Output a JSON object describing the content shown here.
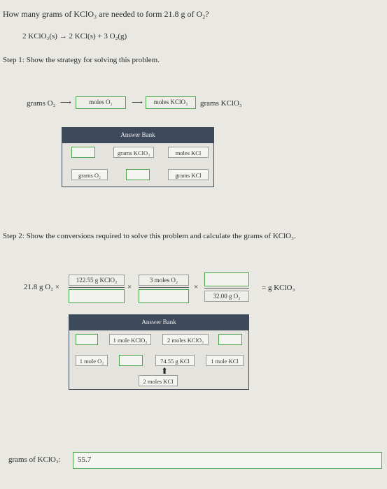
{
  "question": "How many grams of KClO₃ are needed to form 21.8 g of O₂?",
  "equation": "2 KClO₃(s) → 2 KCl(s) + 3 O₂(g)",
  "step1": {
    "title": "Step 1: Show the strategy for solving this problem.",
    "start_label": "grams O₂",
    "slot1": "moles O₂",
    "slot2": "moles KClO₃",
    "end_label": "grams KClO₃",
    "bank_title": "Answer Bank",
    "bank_items": [
      "grams KClO₃",
      "moles KCl",
      "grams O₂",
      "grams KCl"
    ]
  },
  "step2": {
    "title": "Step 2: Show the conversions required to solve this problem and calculate the grams of KClO₃.",
    "start_label": "21.8 g O₂ ×",
    "frac1_num": "122.55 g KClO₃",
    "frac2_num": "3 moles O₂",
    "frac3_den": "32.00 g O₂",
    "times": "×",
    "result_label": "= g KClO₃",
    "bank_title": "Answer Bank",
    "bank_items": [
      "1 mole KClO₃",
      "2 moles KClO₃",
      "1 mole O₂",
      "74.55 g KCl",
      "1 mole KCl",
      "2 moles KCl"
    ]
  },
  "answer": {
    "label": "grams of KClO₃:",
    "value": "55.7"
  }
}
